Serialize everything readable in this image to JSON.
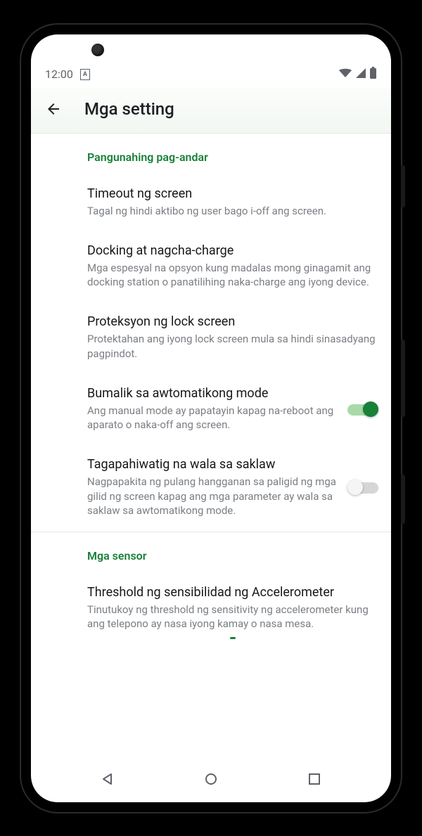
{
  "status": {
    "time": "12:00"
  },
  "appbar": {
    "title": "Mga setting"
  },
  "section1": {
    "header": "Pangunahing pag-andar",
    "items": [
      {
        "title": "Timeout ng screen",
        "sub": "Tagal ng hindi aktibo ng user bago i-off ang screen."
      },
      {
        "title": "Docking at nagcha-charge",
        "sub": "Mga espesyal na opsyon kung madalas mong ginagamit ang docking station o panatilihing naka-charge ang iyong device."
      },
      {
        "title": "Proteksyon ng lock screen",
        "sub": "Protektahan ang iyong lock screen mula sa hindi sinasadyang pagpindot."
      },
      {
        "title": "Bumalik sa awtomatikong mode",
        "sub": "Ang manual mode ay papatayin kapag na-reboot ang aparato o naka-off ang screen.",
        "switch": true
      },
      {
        "title": "Tagapahiwatig na wala sa saklaw",
        "sub": "Nagpapakita ng pulang hangganan sa paligid ng mga gilid ng screen kapag ang mga parameter ay wala sa saklaw sa awtomatikong mode.",
        "switch": false
      }
    ]
  },
  "section2": {
    "header": "Mga sensor",
    "items": [
      {
        "title": "Threshold ng sensibilidad ng Accelerometer",
        "sub": "Tinutukoy ng threshold ng sensitivity ng accelerometer kung ang telepono ay nasa iyong kamay o nasa mesa."
      }
    ]
  },
  "colors": {
    "accent": "#188038"
  }
}
